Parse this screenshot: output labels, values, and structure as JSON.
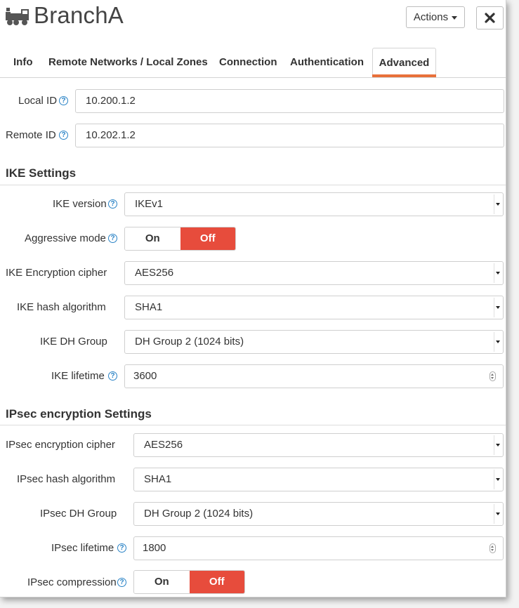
{
  "header": {
    "title": "BranchA",
    "icon": "train-icon",
    "actions_label": "Actions",
    "close_icon": "close-icon"
  },
  "tabs": [
    {
      "label": "Info",
      "active": false
    },
    {
      "label": "Remote Networks / Local Zones",
      "active": false
    },
    {
      "label": "Connection",
      "active": false
    },
    {
      "label": "Authentication",
      "active": false
    },
    {
      "label": "Advanced",
      "active": true
    }
  ],
  "ids": {
    "local_id_label": "Local ID",
    "local_id_value": "10.200.1.2",
    "remote_id_label": "Remote ID",
    "remote_id_value": "10.202.1.2"
  },
  "ike": {
    "section_title": "IKE Settings",
    "version_label": "IKE version",
    "version_value": "IKEv1",
    "aggressive_label": "Aggressive mode",
    "aggressive_on": "On",
    "aggressive_off": "Off",
    "aggressive_selected": "Off",
    "cipher_label": "IKE Encryption cipher",
    "cipher_value": "AES256",
    "hash_label": "IKE hash algorithm",
    "hash_value": "SHA1",
    "dh_label": "IKE DH Group",
    "dh_value": "DH Group 2 (1024 bits)",
    "lifetime_label": "IKE lifetime",
    "lifetime_value": "3600"
  },
  "ipsec": {
    "section_title": "IPsec encryption Settings",
    "cipher_label": "IPsec encryption cipher",
    "cipher_value": "AES256",
    "hash_label": "IPsec hash algorithm",
    "hash_value": "SHA1",
    "dh_label": "IPsec DH Group",
    "dh_value": "DH Group 2 (1024 bits)",
    "lifetime_label": "IPsec lifetime",
    "lifetime_value": "1800",
    "compression_label": "IPsec compression",
    "compression_on": "On",
    "compression_off": "Off",
    "compression_selected": "Off"
  },
  "colors": {
    "accent": "#e8703a",
    "toggle_active": "#e74c3c",
    "help_icon": "#2a83c6"
  }
}
